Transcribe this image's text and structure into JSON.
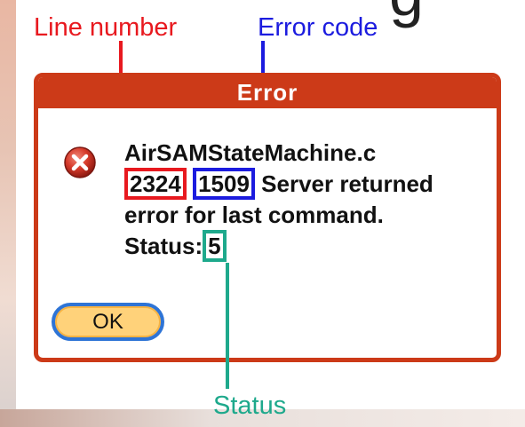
{
  "annotations": {
    "line_number": "Line number",
    "error_code": "Error code",
    "status": "Status"
  },
  "partial_heading_glyph": "g",
  "dialog": {
    "title": "Error",
    "message": {
      "file": "AirSAMStateMachine.c",
      "line_number": "2324",
      "error_code": "1509",
      "text_after_code": "Server returned",
      "text_line3": "error for last command.",
      "status_prefix": "Status:",
      "status_value": "5"
    },
    "ok_label": "OK"
  },
  "colors": {
    "line_number": "#e8191f",
    "error_code": "#1c1cdf",
    "status": "#1ea98c",
    "dialog_frame": "#cc3a18",
    "ok_button_fill": "#ffd27a",
    "ok_button_border": "#2e74d6"
  },
  "icons": {
    "error": "error-x-circle-icon"
  }
}
